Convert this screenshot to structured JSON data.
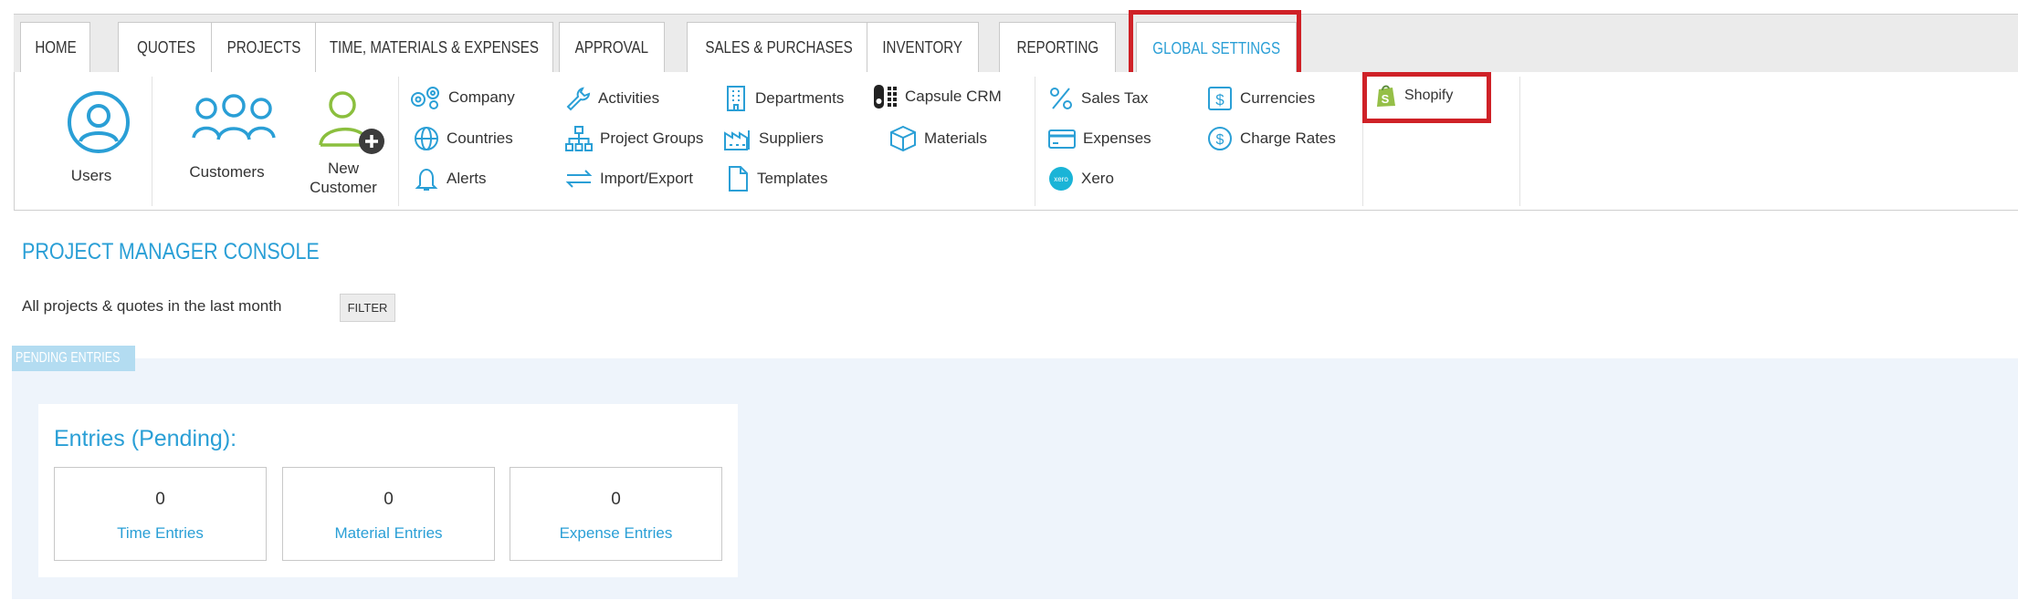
{
  "tabs": [
    {
      "label": "HOME"
    },
    {
      "label": "QUOTES"
    },
    {
      "label": "PROJECTS"
    },
    {
      "label": "TIME, MATERIALS & EXPENSES"
    },
    {
      "label": "APPROVAL"
    },
    {
      "label": "SALES & PURCHASES"
    },
    {
      "label": "INVENTORY"
    },
    {
      "label": "REPORTING"
    },
    {
      "label": "GLOBAL SETTINGS"
    }
  ],
  "ribbon": {
    "users": "Users",
    "customers": "Customers",
    "new_customer": [
      "New",
      "Customer"
    ],
    "company": "Company",
    "countries": "Countries",
    "alerts": "Alerts",
    "activities": "Activities",
    "project_groups": "Project Groups",
    "import_export": "Import/Export",
    "departments": "Departments",
    "suppliers": "Suppliers",
    "templates": "Templates",
    "capsule_crm": "Capsule CRM",
    "materials": "Materials",
    "sales_tax": "Sales Tax",
    "expenses": "Expenses",
    "xero": "Xero",
    "xero_badge": "xero",
    "currencies": "Currencies",
    "charge_rates": "Charge Rates",
    "shopify": "Shopify"
  },
  "console": {
    "title": "PROJECT MANAGER CONSOLE",
    "subtitle": "All projects & quotes in the last month",
    "filter": "FILTER",
    "pending_tag": "PENDING ENTRIES",
    "card_title": "Entries (Pending):",
    "entries": [
      {
        "count": "0",
        "label": "Time Entries"
      },
      {
        "count": "0",
        "label": "Material Entries"
      },
      {
        "count": "0",
        "label": "Expense Entries"
      }
    ]
  },
  "colors": {
    "accent": "#2a9fd6",
    "highlight": "#cf2127",
    "shopify_green": "#95bf47",
    "pending_bg": "#eef4fb"
  }
}
